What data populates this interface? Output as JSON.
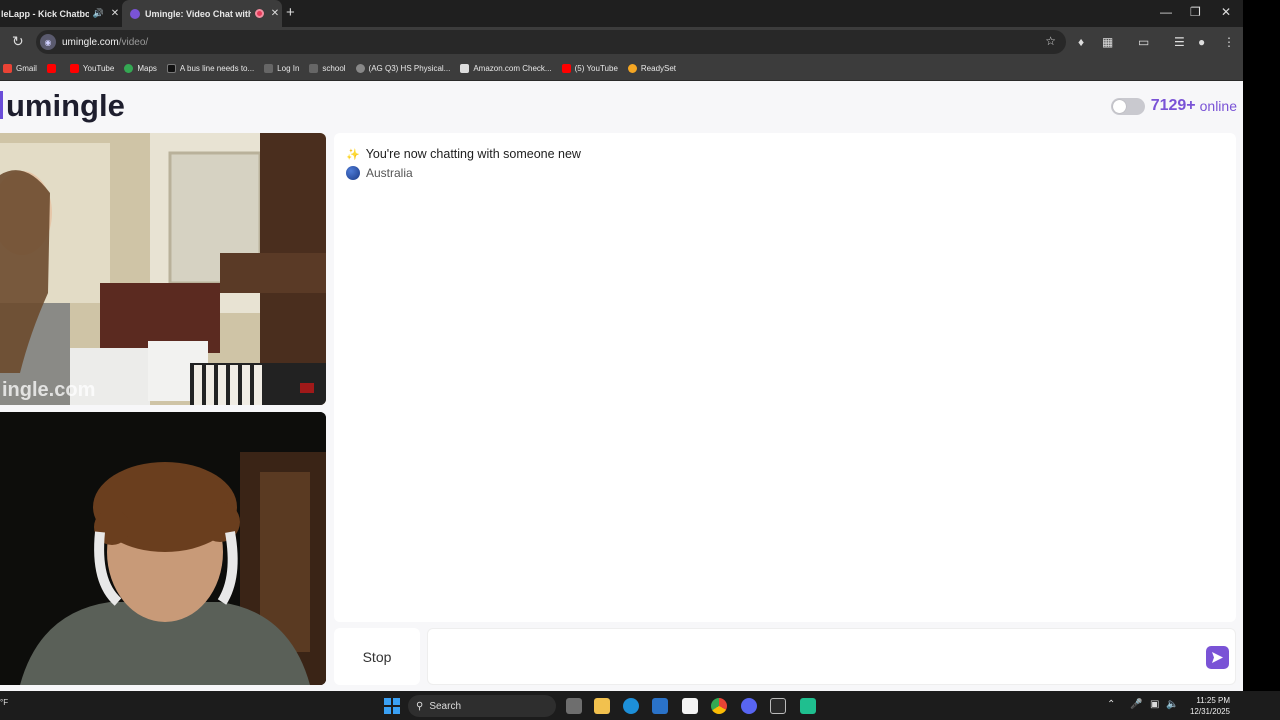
{
  "tabs": [
    {
      "title": "leLapp - Kick Chatbot a",
      "active": false
    },
    {
      "title": "Umingle: Video Chat with S",
      "active": true
    }
  ],
  "address": {
    "host": "umingle.com",
    "path": "/video/"
  },
  "bookmarks": [
    {
      "label": "Gmail",
      "color": "#ea4335"
    },
    {
      "label": "",
      "color": "#ff0000"
    },
    {
      "label": "YouTube",
      "color": "#ff0000"
    },
    {
      "label": "Maps",
      "color": "#34a853"
    },
    {
      "label": "A bus line needs to...",
      "color": "#222222"
    },
    {
      "label": "Log In",
      "color": "#444444"
    },
    {
      "label": "school",
      "color": "#444444"
    },
    {
      "label": "(AG Q3) HS Physical...",
      "color": "#888888"
    },
    {
      "label": "Amazon.com Check...",
      "color": "#dddddd"
    },
    {
      "label": "(5) YouTube",
      "color": "#ff0000"
    },
    {
      "label": "ReadySet",
      "color": "#f5a623"
    }
  ],
  "site": {
    "logo": "umingle",
    "online_count": "7129+",
    "online_label": "online",
    "accent": "#7a53d6"
  },
  "video": {
    "watermark": "ingle.com"
  },
  "chat": {
    "status": "You're now chatting with someone new",
    "country": "Australia"
  },
  "controls": {
    "stop_label": "Stop",
    "message_placeholder": ""
  },
  "taskbar": {
    "weather": "°F",
    "search_label": "Search",
    "time": "11:25 PM",
    "date": "12/31/2025"
  }
}
